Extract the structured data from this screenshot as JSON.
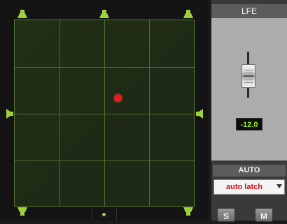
{
  "lfe": {
    "label": "LFE",
    "level": "-12.0"
  },
  "automation": {
    "label": "AUTO",
    "mode": "auto latch"
  },
  "buttons": {
    "solo": "S",
    "mute": "M"
  },
  "colors": {
    "grid_line": "#4f6d2d",
    "speaker": "#9fd13b",
    "puck": "#e8191b",
    "level_text": "#9ef01a",
    "auto_mode_text": "#d01010"
  },
  "icons": {
    "speakers": "speaker-icon",
    "puck": "pan-position-puck",
    "dropdown": "dropdown-caret-icon"
  }
}
